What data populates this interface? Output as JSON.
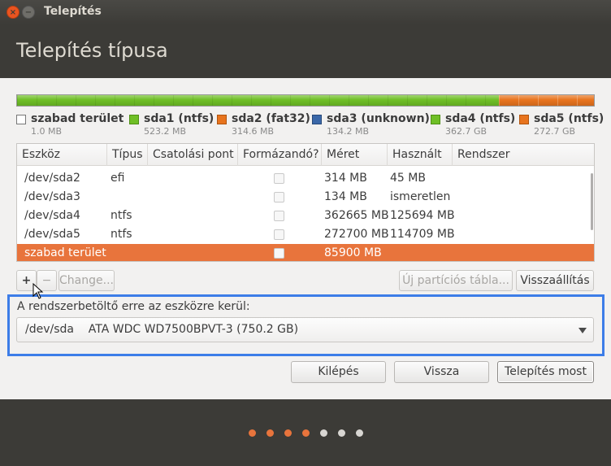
{
  "window": {
    "title": "Telepítés"
  },
  "header": {
    "title": "Telepítés típusa"
  },
  "partition_bar": {
    "colors": {
      "free": "#6fbf26",
      "ntfs": "#e8741e"
    },
    "free_fraction": 0.835
  },
  "legend": [
    {
      "name": "szabad terület",
      "size": "1.0 MB",
      "color": "#ffffff"
    },
    {
      "name": "sda1 (ntfs)",
      "size": "523.2 MB",
      "color": "#6fbf26"
    },
    {
      "name": "sda2 (fat32)",
      "size": "314.6 MB",
      "color": "#e8741e"
    },
    {
      "name": "sda3 (unknown)",
      "size": "134.2 MB",
      "color": "#3b68a9"
    },
    {
      "name": "sda4 (ntfs)",
      "size": "362.7 GB",
      "color": "#6fbf26"
    },
    {
      "name": "sda5 (ntfs)",
      "size": "272.7 GB",
      "color": "#e8741e"
    }
  ],
  "table": {
    "columns": [
      "Eszköz",
      "Típus",
      "Csatolási pont",
      "Formázandó?",
      "Méret",
      "Használt",
      "Rendszer"
    ],
    "rows": [
      {
        "device": "/dev/sda2",
        "type": "efi",
        "mount": "",
        "format": false,
        "size": "314 MB",
        "used": "45 MB",
        "system": ""
      },
      {
        "device": "/dev/sda3",
        "type": "",
        "mount": "",
        "format": false,
        "size": "134 MB",
        "used": "ismeretlen",
        "system": ""
      },
      {
        "device": "/dev/sda4",
        "type": "ntfs",
        "mount": "",
        "format": false,
        "size": "362665 MB",
        "used": "125694 MB",
        "system": ""
      },
      {
        "device": "/dev/sda5",
        "type": "ntfs",
        "mount": "",
        "format": false,
        "size": "272700 MB",
        "used": "114709 MB",
        "system": ""
      },
      {
        "device": "szabad terület",
        "type": "",
        "mount": "",
        "format": false,
        "size": "85900 MB",
        "used": "",
        "system": "",
        "selected": true
      }
    ],
    "selected_color": "#e8743c"
  },
  "toolbar": {
    "add_label": "+",
    "remove_label": "−",
    "change_label": "Change...",
    "new_table_label": "Új partíciós tábla...",
    "revert_label": "Visszaállítás"
  },
  "bootloader": {
    "label": "A rendszerbetöltő erre az eszközre kerül:",
    "selected_value": "/dev/sda    ATA WDC WD7500BPVT-3 (750.2 GB)",
    "highlight_color": "#3d7de8"
  },
  "buttons": {
    "quit_label": "Kilépés",
    "back_label": "Vissza",
    "install_label": "Telepítés most"
  },
  "progress": {
    "total_steps": 7,
    "completed_steps": 4
  }
}
